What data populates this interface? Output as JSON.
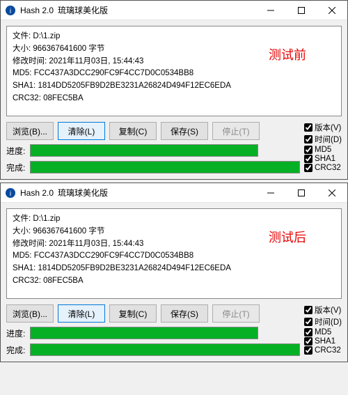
{
  "windows": [
    {
      "title": "Hash 2.0",
      "subtitle": "琉璃球美化版",
      "stamp": "测试前",
      "info": {
        "file_label": "文件:",
        "file_value": "D:\\1.zip",
        "size_label": "大小:",
        "size_value": "966367641600 字节",
        "mtime_label": "修改时间:",
        "mtime_value": "2021年11月03日, 15:44:43",
        "md5_label": "MD5:",
        "md5_value": "FCC437A3DCC290FC9F4CC7D0C0534BB8",
        "sha1_label": "SHA1:",
        "sha1_value": "1814DD5205FB9D2BE3231A26824D494F12EC6EDA",
        "crc32_label": "CRC32:",
        "crc32_value": "08FEC5BA"
      },
      "buttons": {
        "browse": "浏览(B)...",
        "clear": "清除(L)",
        "copy": "复制(C)",
        "save": "保存(S)",
        "stop": "停止(T)"
      },
      "checks": {
        "version": "版本(V)",
        "time": "时间(D)",
        "md5": "MD5",
        "sha1": "SHA1",
        "crc32": "CRC32"
      },
      "progress": {
        "label1": "进度:",
        "label2": "完成:",
        "p1_width": 328,
        "p2_width": 388,
        "p1_fill": 100,
        "p2_fill": 100
      }
    },
    {
      "title": "Hash 2.0",
      "subtitle": "琉璃球美化版",
      "stamp": "测试后",
      "info": {
        "file_label": "文件:",
        "file_value": "D:\\1.zip",
        "size_label": "大小:",
        "size_value": "966367641600 字节",
        "mtime_label": "修改时间:",
        "mtime_value": "2021年11月03日, 15:44:43",
        "md5_label": "MD5:",
        "md5_value": "FCC437A3DCC290FC9F4CC7D0C0534BB8",
        "sha1_label": "SHA1:",
        "sha1_value": "1814DD5205FB9D2BE3231A26824D494F12EC6EDA",
        "crc32_label": "CRC32:",
        "crc32_value": "08FEC5BA"
      },
      "buttons": {
        "browse": "浏览(B)...",
        "clear": "清除(L)",
        "copy": "复制(C)",
        "save": "保存(S)",
        "stop": "停止(T)"
      },
      "checks": {
        "version": "版本(V)",
        "time": "时间(D)",
        "md5": "MD5",
        "sha1": "SHA1",
        "crc32": "CRC32"
      },
      "progress": {
        "label1": "进度:",
        "label2": "完成:",
        "p1_width": 328,
        "p2_width": 388,
        "p1_fill": 100,
        "p2_fill": 100
      }
    }
  ]
}
